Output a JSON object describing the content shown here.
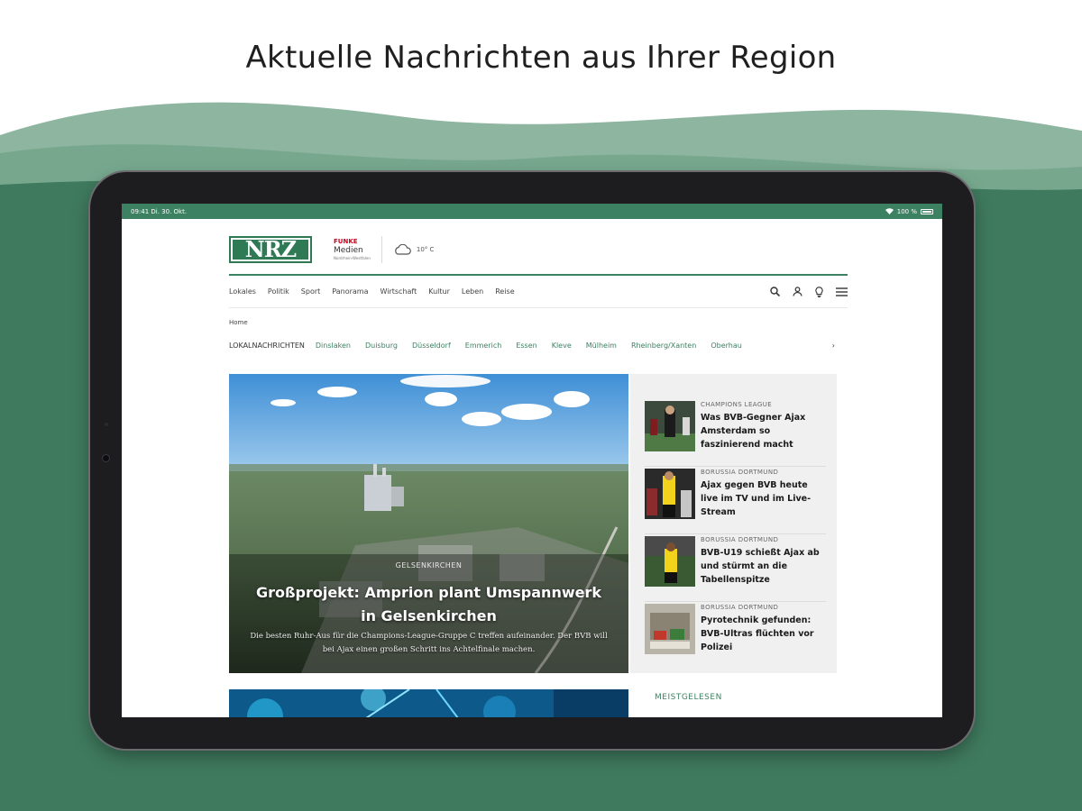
{
  "headline": "Aktuelle Nachrichten aus Ihrer Region",
  "colors": {
    "brand_green": "#3c8162",
    "wave_dark": "#3f7a5e",
    "wave_light": "#8db59f"
  },
  "statusbar": {
    "time": "09:41 Di. 30. Okt.",
    "battery": "100 %"
  },
  "brand": {
    "logo": "NRZ",
    "funke_top": "FUNKE",
    "funke_mid": "Medien",
    "funke_bot": "Nordrhein-Westfalen",
    "weather_icon": "cloud-icon",
    "temperature": "10° C"
  },
  "nav": {
    "links": [
      "Lokales",
      "Politik",
      "Sport",
      "Panorama",
      "Wirtschaft",
      "Kultur",
      "Leben",
      "Reise"
    ],
    "icons": [
      "search-icon",
      "user-icon",
      "lightbulb-icon",
      "menu-icon"
    ]
  },
  "breadcrumb": "Home",
  "lokal": {
    "label": "LOKALNACHRICHTEN",
    "items": [
      "Dinslaken",
      "Duisburg",
      "Düsseldorf",
      "Emmerich",
      "Essen",
      "Kleve",
      "Mülheim",
      "Rheinberg/Xanten",
      "Oberhau"
    ],
    "more_icon": "chevron-right-icon",
    "more": "›"
  },
  "hero": {
    "kicker": "GELSENKIRCHEN",
    "title": "Großprojekt: Amprion plant Umspannwerk in Gelsenkirchen",
    "teaser": "Die besten Ruhr-Aus für die Champions-League-Gruppe C treffen aufeinander. Der BVB will bei Ajax einen großen Schritt ins Achtelfinale machen."
  },
  "sidebar": [
    {
      "kicker": "CHAMPIONS LEAGUE",
      "title": "Was BVB-Gegner Ajax Amsterdam so faszinierend macht"
    },
    {
      "kicker": "BORUSSIA DORTMUND",
      "title": "Ajax gegen BVB heute live im TV und im Live-Stream"
    },
    {
      "kicker": "BORUSSIA DORTMUND",
      "title": "BVB-U19 schießt Ajax ab und stürmt an die Tabellenspitze"
    },
    {
      "kicker": "BORUSSIA DORTMUND",
      "title": "Pyrotechnik gefunden: BVB-Ultras flüchten vor Polizei"
    }
  ],
  "meistgelesen": "MEISTGELESEN"
}
